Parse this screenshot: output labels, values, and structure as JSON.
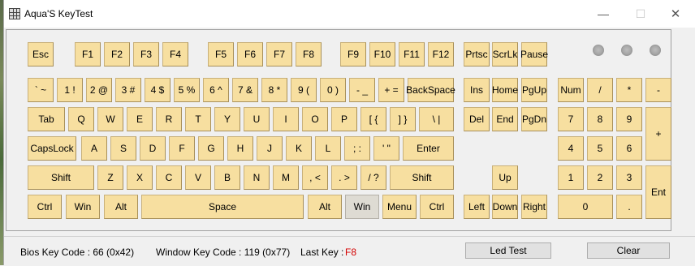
{
  "window": {
    "title": "Aqua'S KeyTest",
    "controls": {
      "minimize": "—",
      "maximize": "☐",
      "close": "✕"
    }
  },
  "keys": {
    "esc": "Esc",
    "f1": "F1",
    "f2": "F2",
    "f3": "F3",
    "f4": "F4",
    "f5": "F5",
    "f6": "F6",
    "f7": "F7",
    "f8": "F8",
    "f9": "F9",
    "f10": "F10",
    "f11": "F11",
    "f12": "F12",
    "prtsc": "Prtsc",
    "scrlk": "ScrLk",
    "pause": "Pause",
    "backtick": "` ~",
    "1": "1 !",
    "2": "2 @",
    "3": "3 #",
    "4": "4 $",
    "5": "5 %",
    "6": "6 ^",
    "7": "7 &",
    "8": "8 *",
    "9": "9 (",
    "0": "0 )",
    "minus": "- _",
    "equals": "+ =",
    "backspace": "BackSpace",
    "ins": "Ins",
    "home": "Home",
    "pgup": "PgUp",
    "numlock": "Num",
    "num_div": "/",
    "num_mul": "*",
    "num_sub": "-",
    "tab": "Tab",
    "q": "Q",
    "w": "W",
    "e": "E",
    "r": "R",
    "t": "T",
    "y": "Y",
    "u": "U",
    "i": "I",
    "o": "O",
    "p": "P",
    "lbracket": "[ {",
    "rbracket": "] }",
    "backslash": "\\ |",
    "del": "Del",
    "end": "End",
    "pgdn": "PgDn",
    "num7": "7",
    "num8": "8",
    "num9": "9",
    "num_add": "+",
    "capslock": "CapsLock",
    "a": "A",
    "s": "S",
    "d": "D",
    "f": "F",
    "g": "G",
    "h": "H",
    "j": "J",
    "k": "K",
    "l": "L",
    "semicolon": "; :",
    "quote": "' \"",
    "enter": "Enter",
    "num4": "4",
    "num5": "5",
    "num6": "6",
    "lshift": "Shift",
    "z": "Z",
    "x": "X",
    "c": "C",
    "v": "V",
    "b": "B",
    "n": "N",
    "m": "M",
    "comma": ", <",
    "period": ". >",
    "slash": "/ ?",
    "rshift": "Shift",
    "up": "Up",
    "num1": "1",
    "num2": "2",
    "num3": "3",
    "num_enter": "Ent",
    "lctrl": "Ctrl",
    "lwin": "Win",
    "lalt": "Alt",
    "space": "Space",
    "ralt": "Alt",
    "rwin": "Win",
    "menu": "Menu",
    "rctrl": "Ctrl",
    "left": "Left",
    "down": "Down",
    "right": "Right",
    "num0": "0",
    "num_dot": "."
  },
  "status": {
    "bios_label": "Bios Key Code : 66 (0x42)",
    "window_label": "Window Key Code : 119 (0x77)",
    "last_key_label": "Last Key :",
    "last_key_value": "F8",
    "led_test": "Led Test",
    "clear": "Clear"
  },
  "colors": {
    "key_face": "#f7dfa0",
    "key_pressed": "#dedbd3",
    "last_key_text": "#d40000"
  }
}
